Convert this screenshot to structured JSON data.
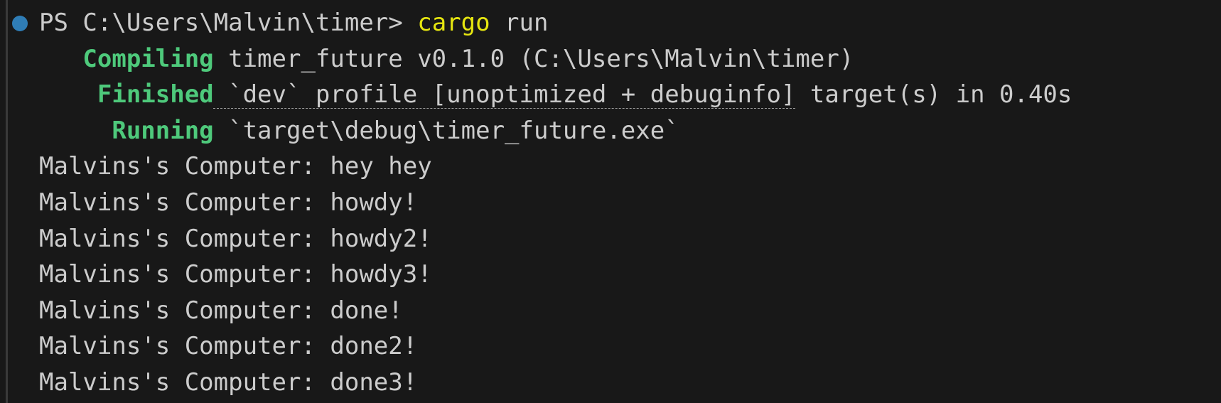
{
  "prompt": {
    "text": "PS C:\\Users\\Malvin\\timer> ",
    "command": "cargo",
    "args": " run"
  },
  "build": [
    {
      "status": "   Compiling",
      "detail": " timer_future v0.1.0 (C:\\Users\\Malvin\\timer)"
    },
    {
      "status": "    Finished",
      "detail_link": " `dev` profile [unoptimized + debuginfo]",
      "detail_rest": " target(s) in 0.40s"
    },
    {
      "status": "     Running",
      "detail": " `target\\debug\\timer_future.exe`"
    }
  ],
  "output": [
    "Malvins's Computer: hey hey",
    "Malvins's Computer: howdy!",
    "Malvins's Computer: howdy2!",
    "Malvins's Computer: howdy3!",
    "Malvins's Computer: done!",
    "Malvins's Computer: done2!",
    "Malvins's Computer: done3!"
  ],
  "colors": {
    "background": "#181818",
    "text": "#cccccc",
    "command": "#e5e510",
    "status": "#4ec97b",
    "decoration_dot": "#2f7db6"
  }
}
